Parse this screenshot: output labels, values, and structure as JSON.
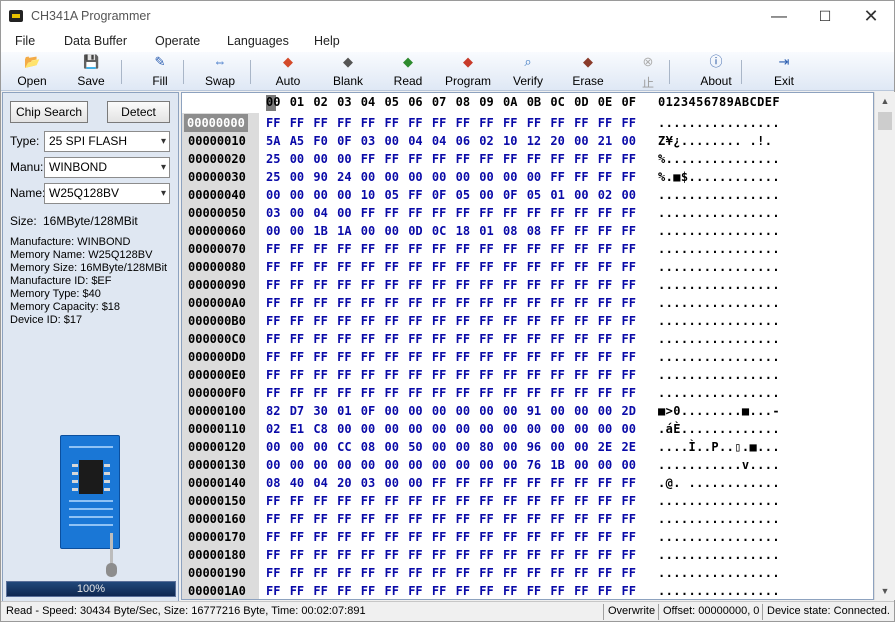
{
  "window": {
    "title": "CH341A Programmer"
  },
  "window_controls": {
    "minimize": "—",
    "maximize": "☐",
    "close": "✕"
  },
  "menu": [
    "File",
    "Data Buffer",
    "Operate",
    "Languages",
    "Help"
  ],
  "toolbar": [
    {
      "label": "Open",
      "icon": "folder-icon",
      "glyph": "📂",
      "color": "#d9a520"
    },
    {
      "label": "Save",
      "icon": "floppy-icon",
      "glyph": "💾",
      "color": "#2a5db0"
    },
    {
      "label": "Fill",
      "icon": "fill-icon",
      "glyph": "✎",
      "color": "#2a5db0"
    },
    {
      "label": "Swap",
      "icon": "swap-icon",
      "glyph": "⇔",
      "color": "#1f5fbf"
    },
    {
      "label": "Auto",
      "icon": "auto-icon",
      "glyph": "◆",
      "color": "#d44a2a"
    },
    {
      "label": "Blank",
      "icon": "blank-chip-icon",
      "glyph": "◆",
      "color": "#555555"
    },
    {
      "label": "Read",
      "icon": "read-chip-icon",
      "glyph": "◆",
      "color": "#2e8b2e"
    },
    {
      "label": "Program",
      "icon": "program-chip-icon",
      "glyph": "◆",
      "color": "#c83a2a"
    },
    {
      "label": "Verify",
      "icon": "verify-icon",
      "glyph": "⌕",
      "color": "#3b78c2"
    },
    {
      "label": "Erase",
      "icon": "erase-icon",
      "glyph": "◆",
      "color": "#8a3a2a"
    },
    {
      "label": "止",
      "icon": "stop-icon",
      "glyph": "⊗",
      "color": "#b0b0b0",
      "disabled": true
    },
    {
      "label": "About",
      "icon": "info-icon",
      "glyph": "ⓘ",
      "color": "#1f4f9f"
    },
    {
      "label": "Exit",
      "icon": "exit-icon",
      "glyph": "⇥",
      "color": "#2a5db0"
    }
  ],
  "left_panel": {
    "chip_search": "Chip Search",
    "detect": "Detect",
    "type_label": "Type:",
    "type_value": "25 SPI FLASH",
    "manu_label": "Manu:",
    "manu_value": "WINBOND",
    "name_label": "Name:",
    "name_value": "W25Q128BV",
    "size_label": "Size:",
    "size_value": "16MByte/128MBit",
    "info_lines": [
      "Manufacture: WINBOND",
      "Memory Name: W25Q128BV",
      "Memory Size: 16MByte/128MBit",
      "Manufacture ID: $EF",
      "Memory Type: $40",
      "Memory Capacity: $18",
      "Device ID: $17"
    ],
    "progress_percent": 100,
    "progress_text": "100%"
  },
  "hex_view": {
    "column_headers": [
      "00",
      "01",
      "02",
      "03",
      "04",
      "05",
      "06",
      "07",
      "08",
      "09",
      "0A",
      "0B",
      "0C",
      "0D",
      "0E",
      "0F"
    ],
    "ascii_header": "0123456789ABCDEF",
    "selected_row": 0,
    "rows": [
      {
        "addr": "00000000",
        "bytes": [
          "FF",
          "FF",
          "FF",
          "FF",
          "FF",
          "FF",
          "FF",
          "FF",
          "FF",
          "FF",
          "FF",
          "FF",
          "FF",
          "FF",
          "FF",
          "FF"
        ],
        "ascii": "................"
      },
      {
        "addr": "00000010",
        "bytes": [
          "5A",
          "A5",
          "F0",
          "0F",
          "03",
          "00",
          "04",
          "04",
          "06",
          "02",
          "10",
          "12",
          "20",
          "00",
          "21",
          "00"
        ],
        "ascii": "Z¥¿........ .!."
      },
      {
        "addr": "00000020",
        "bytes": [
          "25",
          "00",
          "00",
          "00",
          "FF",
          "FF",
          "FF",
          "FF",
          "FF",
          "FF",
          "FF",
          "FF",
          "FF",
          "FF",
          "FF",
          "FF"
        ],
        "ascii": "%..............."
      },
      {
        "addr": "00000030",
        "bytes": [
          "25",
          "00",
          "90",
          "24",
          "00",
          "00",
          "00",
          "00",
          "00",
          "00",
          "00",
          "00",
          "FF",
          "FF",
          "FF",
          "FF"
        ],
        "ascii": "%.■$............"
      },
      {
        "addr": "00000040",
        "bytes": [
          "00",
          "00",
          "00",
          "00",
          "10",
          "05",
          "FF",
          "0F",
          "05",
          "00",
          "0F",
          "05",
          "01",
          "00",
          "02",
          "00"
        ],
        "ascii": "................"
      },
      {
        "addr": "00000050",
        "bytes": [
          "03",
          "00",
          "04",
          "00",
          "FF",
          "FF",
          "FF",
          "FF",
          "FF",
          "FF",
          "FF",
          "FF",
          "FF",
          "FF",
          "FF",
          "FF"
        ],
        "ascii": "................"
      },
      {
        "addr": "00000060",
        "bytes": [
          "00",
          "00",
          "1B",
          "1A",
          "00",
          "00",
          "0D",
          "0C",
          "18",
          "01",
          "08",
          "08",
          "FF",
          "FF",
          "FF",
          "FF"
        ],
        "ascii": "................"
      },
      {
        "addr": "00000070",
        "bytes": [
          "FF",
          "FF",
          "FF",
          "FF",
          "FF",
          "FF",
          "FF",
          "FF",
          "FF",
          "FF",
          "FF",
          "FF",
          "FF",
          "FF",
          "FF",
          "FF"
        ],
        "ascii": "................"
      },
      {
        "addr": "00000080",
        "bytes": [
          "FF",
          "FF",
          "FF",
          "FF",
          "FF",
          "FF",
          "FF",
          "FF",
          "FF",
          "FF",
          "FF",
          "FF",
          "FF",
          "FF",
          "FF",
          "FF"
        ],
        "ascii": "................"
      },
      {
        "addr": "00000090",
        "bytes": [
          "FF",
          "FF",
          "FF",
          "FF",
          "FF",
          "FF",
          "FF",
          "FF",
          "FF",
          "FF",
          "FF",
          "FF",
          "FF",
          "FF",
          "FF",
          "FF"
        ],
        "ascii": "................"
      },
      {
        "addr": "000000A0",
        "bytes": [
          "FF",
          "FF",
          "FF",
          "FF",
          "FF",
          "FF",
          "FF",
          "FF",
          "FF",
          "FF",
          "FF",
          "FF",
          "FF",
          "FF",
          "FF",
          "FF"
        ],
        "ascii": "................"
      },
      {
        "addr": "000000B0",
        "bytes": [
          "FF",
          "FF",
          "FF",
          "FF",
          "FF",
          "FF",
          "FF",
          "FF",
          "FF",
          "FF",
          "FF",
          "FF",
          "FF",
          "FF",
          "FF",
          "FF"
        ],
        "ascii": "................"
      },
      {
        "addr": "000000C0",
        "bytes": [
          "FF",
          "FF",
          "FF",
          "FF",
          "FF",
          "FF",
          "FF",
          "FF",
          "FF",
          "FF",
          "FF",
          "FF",
          "FF",
          "FF",
          "FF",
          "FF"
        ],
        "ascii": "................"
      },
      {
        "addr": "000000D0",
        "bytes": [
          "FF",
          "FF",
          "FF",
          "FF",
          "FF",
          "FF",
          "FF",
          "FF",
          "FF",
          "FF",
          "FF",
          "FF",
          "FF",
          "FF",
          "FF",
          "FF"
        ],
        "ascii": "................"
      },
      {
        "addr": "000000E0",
        "bytes": [
          "FF",
          "FF",
          "FF",
          "FF",
          "FF",
          "FF",
          "FF",
          "FF",
          "FF",
          "FF",
          "FF",
          "FF",
          "FF",
          "FF",
          "FF",
          "FF"
        ],
        "ascii": "................"
      },
      {
        "addr": "000000F0",
        "bytes": [
          "FF",
          "FF",
          "FF",
          "FF",
          "FF",
          "FF",
          "FF",
          "FF",
          "FF",
          "FF",
          "FF",
          "FF",
          "FF",
          "FF",
          "FF",
          "FF"
        ],
        "ascii": "................"
      },
      {
        "addr": "00000100",
        "bytes": [
          "82",
          "D7",
          "30",
          "01",
          "0F",
          "00",
          "00",
          "00",
          "00",
          "00",
          "00",
          "91",
          "00",
          "00",
          "00",
          "2D"
        ],
        "ascii": "■>0........■...-"
      },
      {
        "addr": "00000110",
        "bytes": [
          "02",
          "E1",
          "C8",
          "00",
          "00",
          "00",
          "00",
          "00",
          "00",
          "00",
          "00",
          "00",
          "00",
          "00",
          "00",
          "00"
        ],
        "ascii": ".áÈ............."
      },
      {
        "addr": "00000120",
        "bytes": [
          "00",
          "00",
          "00",
          "CC",
          "08",
          "00",
          "50",
          "00",
          "00",
          "80",
          "00",
          "96",
          "00",
          "00",
          "2E",
          "2E"
        ],
        "ascii": "....Ì..P..▯.■..."
      },
      {
        "addr": "00000130",
        "bytes": [
          "00",
          "00",
          "00",
          "00",
          "00",
          "00",
          "00",
          "00",
          "00",
          "00",
          "00",
          "76",
          "1B",
          "00",
          "00",
          "00"
        ],
        "ascii": "...........v...."
      },
      {
        "addr": "00000140",
        "bytes": [
          "08",
          "40",
          "04",
          "20",
          "03",
          "00",
          "00",
          "FF",
          "FF",
          "FF",
          "FF",
          "FF",
          "FF",
          "FF",
          "FF",
          "FF"
        ],
        "ascii": ".@. ............"
      },
      {
        "addr": "00000150",
        "bytes": [
          "FF",
          "FF",
          "FF",
          "FF",
          "FF",
          "FF",
          "FF",
          "FF",
          "FF",
          "FF",
          "FF",
          "FF",
          "FF",
          "FF",
          "FF",
          "FF"
        ],
        "ascii": "................"
      },
      {
        "addr": "00000160",
        "bytes": [
          "FF",
          "FF",
          "FF",
          "FF",
          "FF",
          "FF",
          "FF",
          "FF",
          "FF",
          "FF",
          "FF",
          "FF",
          "FF",
          "FF",
          "FF",
          "FF"
        ],
        "ascii": "................"
      },
      {
        "addr": "00000170",
        "bytes": [
          "FF",
          "FF",
          "FF",
          "FF",
          "FF",
          "FF",
          "FF",
          "FF",
          "FF",
          "FF",
          "FF",
          "FF",
          "FF",
          "FF",
          "FF",
          "FF"
        ],
        "ascii": "................"
      },
      {
        "addr": "00000180",
        "bytes": [
          "FF",
          "FF",
          "FF",
          "FF",
          "FF",
          "FF",
          "FF",
          "FF",
          "FF",
          "FF",
          "FF",
          "FF",
          "FF",
          "FF",
          "FF",
          "FF"
        ],
        "ascii": "................"
      },
      {
        "addr": "00000190",
        "bytes": [
          "FF",
          "FF",
          "FF",
          "FF",
          "FF",
          "FF",
          "FF",
          "FF",
          "FF",
          "FF",
          "FF",
          "FF",
          "FF",
          "FF",
          "FF",
          "FF"
        ],
        "ascii": "................"
      },
      {
        "addr": "000001A0",
        "bytes": [
          "FF",
          "FF",
          "FF",
          "FF",
          "FF",
          "FF",
          "FF",
          "FF",
          "FF",
          "FF",
          "FF",
          "FF",
          "FF",
          "FF",
          "FF",
          "FF"
        ],
        "ascii": "................"
      }
    ]
  },
  "scrollbar": {
    "up": "▲",
    "down": "▼"
  },
  "status": {
    "main": "Read - Speed: 30434 Byte/Sec, Size: 16777216 Byte, Time: 00:02:07:891",
    "mode": "Overwrite",
    "offset": "Offset: 00000000, 0",
    "device_state": "Device state: Connected."
  }
}
